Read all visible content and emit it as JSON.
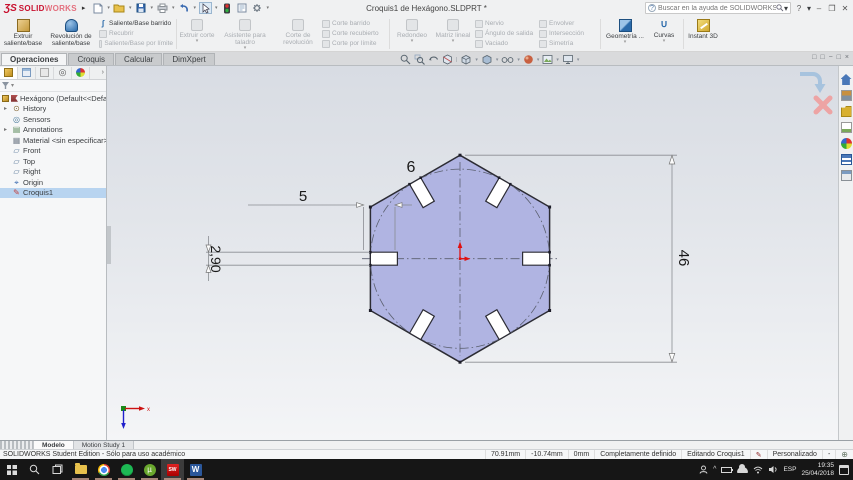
{
  "titlebar": {
    "logo_mark": "ƷS",
    "logo_solid": "SOLID",
    "logo_works": "WORKS",
    "title": "Croquis1 de Hexágono.SLDPRT *",
    "search_placeholder": "Buscar en la ayuda de SOLIDWORKS",
    "help": "?",
    "minimize": "–",
    "restore": "❐",
    "close": "✕"
  },
  "manager_tabs": {
    "items": [
      "Operaciones",
      "Croquis",
      "Calcular",
      "DimXpert"
    ]
  },
  "ribbon": {
    "extrude": "Extruir saliente/base",
    "revolve": "Revolución de saliente/base",
    "sweep": "Saliente/Base barrido",
    "loft": "Recubrir",
    "boundary": "Saliente/Base por límite",
    "cut_extrude": "Extruir corte",
    "hole_wizard": "Asistente para taladro",
    "cut_revolve": "Corte de revolución",
    "cut_sweep": "Corte barrido",
    "cut_loft": "Corte recubierto",
    "cut_boundary": "Corte por límite",
    "fillet": "Redondeo",
    "pattern": "Matriz lineal",
    "rib": "Nervio",
    "draft": "Ángulo de salida",
    "shell": "Vaciado",
    "wrap": "Envolver",
    "intersect": "Intersección",
    "mirror": "Simetría",
    "ref_geometry": "Geometría ...",
    "curves": "Curvas",
    "instant3d": "Instant 3D"
  },
  "feature_tree": {
    "root": "Hexágono (Default<<Default>",
    "history": "History",
    "sensors": "Sensors",
    "annotations": "Annotations",
    "material": "Material <sin especificar>",
    "front": "Front",
    "top": "Top",
    "right": "Right",
    "origin": "Origin",
    "sketch": "Croquis1"
  },
  "sketch_dims": {
    "slot_depth": "6",
    "slot_offset": "5",
    "slot_width": "2,90",
    "height": "46"
  },
  "bottom_tabs": {
    "model": "Modelo",
    "motion": "Motion Study 1"
  },
  "statusbar": {
    "edition": "SOLIDWORKS Student Edition - Sólo para uso académico",
    "x": "70.91mm",
    "y": "-10.74mm",
    "z": "0mm",
    "state": "Completamente definido",
    "editing": "Editando Croquis1",
    "config": "Personalizado",
    "dropdown": "-"
  },
  "taskbar": {
    "utorrent_glyph": "µ",
    "sw_glyph": "SW",
    "word_glyph": "W",
    "lang": "ESP",
    "time": "19:35",
    "date": "25/04/2018"
  }
}
